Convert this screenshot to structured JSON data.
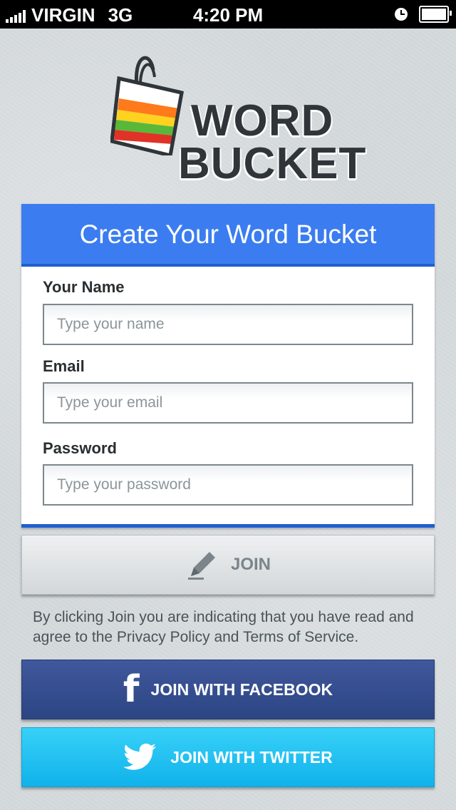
{
  "status_bar": {
    "carrier": "VIRGIN",
    "network": "3G",
    "time": "4:20 PM"
  },
  "logo": {
    "line1": "WORD",
    "line2": "BUCKET"
  },
  "form": {
    "title": "Create Your Word Bucket",
    "name_label": "Your Name",
    "name_placeholder": "Type your name",
    "email_label": "Email",
    "email_placeholder": "Type your email",
    "password_label": "Password",
    "password_placeholder": "Type your password"
  },
  "join_label": "JOIN",
  "legal_text": "By clicking Join you are indicating that you have read and agree to the Privacy Policy and Terms of Service.",
  "facebook_label": "JOIN WITH FACEBOOK",
  "twitter_label": "JOIN WITH TWITTER",
  "colors": {
    "header_blue": "#3b7df0",
    "facebook_blue": "#34509a",
    "twitter_blue": "#22c3f3"
  }
}
